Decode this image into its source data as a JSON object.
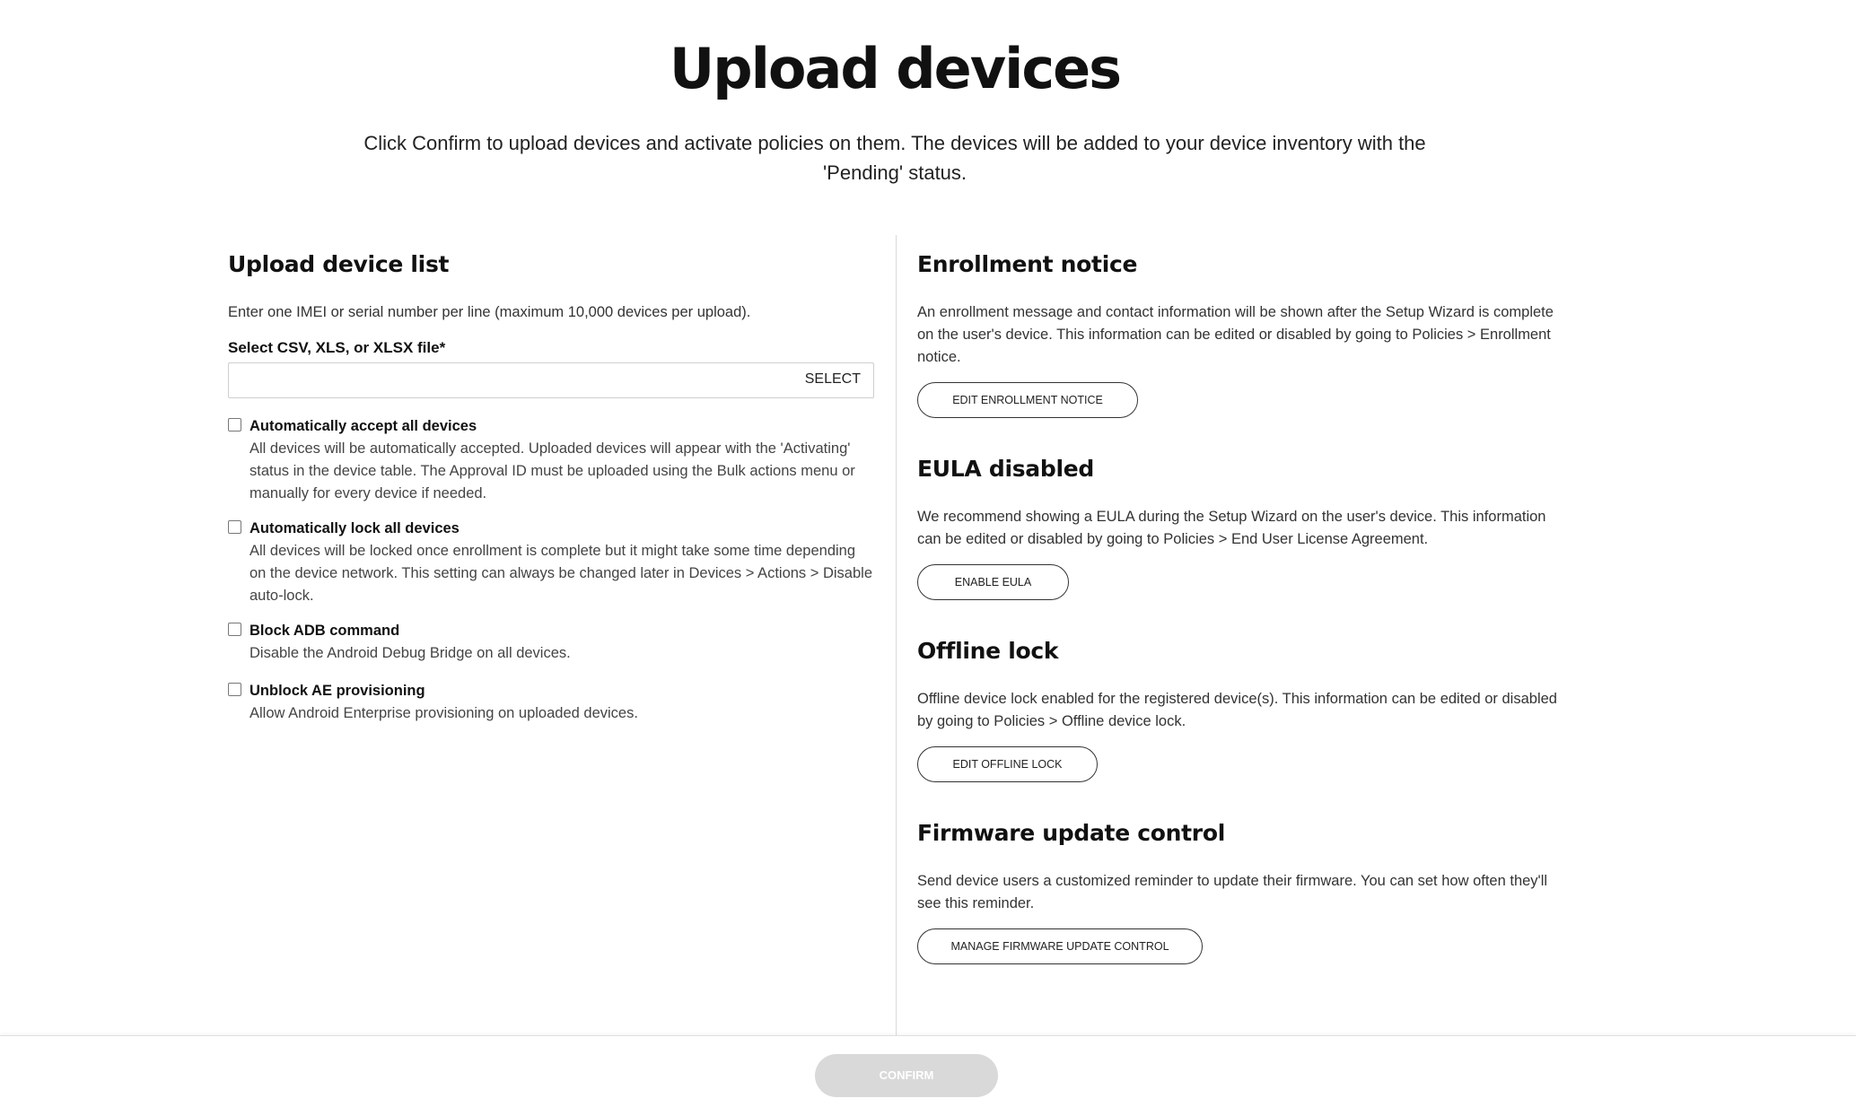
{
  "page": {
    "title": "Upload devices",
    "subtitle": "Click Confirm to upload devices and activate policies on them. The devices will be added to your device inventory with the 'Pending' status."
  },
  "upload": {
    "heading": "Upload device list",
    "description": "Enter one IMEI or serial number per line (maximum 10,000 devices per upload).",
    "file_label": "Select CSV, XLS, or XLSX file*",
    "file_value": "",
    "select_label": "SELECT",
    "options": [
      {
        "title": "Automatically accept all devices",
        "description": "All devices will be automatically accepted. Uploaded devices will appear with the 'Activating' status in the device table. The Approval ID must be uploaded using the Bulk actions menu or manually for every device if needed.",
        "checked": false
      },
      {
        "title": "Automatically lock all devices",
        "description": "All devices will be locked once enrollment is complete but it might take some time depending on the device network. This setting can always be changed later in Devices > Actions > Disable auto-lock.",
        "checked": false
      },
      {
        "title": "Block ADB command",
        "description": "Disable the Android Debug Bridge on all devices.",
        "checked": false
      },
      {
        "title": "Unblock AE provisioning",
        "description": "Allow Android Enterprise provisioning on uploaded devices.",
        "checked": false
      }
    ]
  },
  "sections": [
    {
      "heading": "Enrollment notice",
      "description": "An enrollment message and contact information will be shown after the Setup Wizard is complete on the user's device. This information can be edited or disabled by going to Policies > Enrollment notice.",
      "button": "EDIT ENROLLMENT NOTICE"
    },
    {
      "heading": "EULA disabled",
      "description": "We recommend showing a EULA during the Setup Wizard on the user's device. This information can be edited or disabled by going to Policies > End User License Agreement.",
      "button": "ENABLE EULA"
    },
    {
      "heading": "Offline lock",
      "description": "Offline device lock enabled for the registered device(s). This information can be edited or disabled by going to Policies > Offline device lock.",
      "button": "EDIT OFFLINE LOCK"
    },
    {
      "heading": "Firmware update control",
      "description": "Send device users a customized reminder to update their firmware. You can set how often they'll see this reminder.",
      "button": "MANAGE FIRMWARE UPDATE CONTROL"
    }
  ],
  "footer": {
    "confirm_label": "CONFIRM",
    "confirm_enabled": false
  }
}
